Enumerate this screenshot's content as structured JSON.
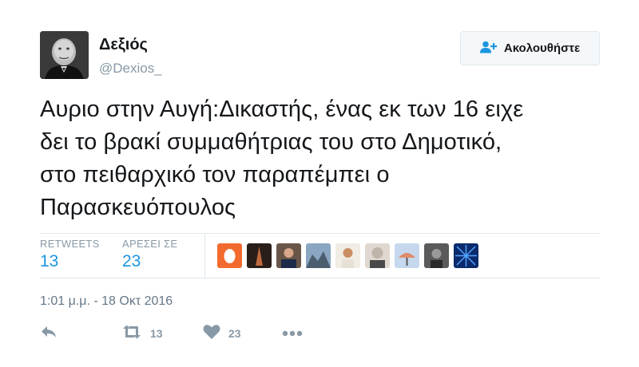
{
  "user": {
    "name": "Δεξιός",
    "handle": "@Dexios_"
  },
  "follow_button": {
    "label": "Ακολουθήστε",
    "icon": "follow-person-plus-icon"
  },
  "tweet": {
    "lines": [
      "Αυριο στην Αυγή:Δικαστής, ένας εκ των 16 ειχε",
      "δει το βρακί συμμαθήτριας του στο Δημοτικό,",
      "στο πειθαρχικό τον παραπέμπει ο",
      "Παρασκευόπουλος"
    ]
  },
  "stats": {
    "retweets_label": "RETWEETS",
    "retweets_value": "13",
    "likes_label": "ΑΡΕΣΕΙ ΣΕ",
    "likes_value": "23"
  },
  "likers": [
    {
      "color": "#f26a2e"
    },
    {
      "color": "#3a2a22"
    },
    {
      "color": "#5a4438"
    },
    {
      "color": "#7f97b1"
    },
    {
      "color": "#e4d6c4"
    },
    {
      "color": "#d9d2cc"
    },
    {
      "color": "#b5c8e0"
    },
    {
      "color": "#4a4a4a"
    },
    {
      "color": "#0b2a6b"
    }
  ],
  "timestamp": "1:01 μ.μ. - 18 Οκτ 2016",
  "actions": {
    "reply_icon": "reply-icon",
    "retweet_icon": "retweet-icon",
    "retweet_count": "13",
    "like_icon": "heart-icon",
    "like_count": "23",
    "more_icon": "more-dots-icon"
  },
  "colors": {
    "accent": "#1b95e0",
    "muted": "#8899a6",
    "border": "#e1e8ed"
  }
}
